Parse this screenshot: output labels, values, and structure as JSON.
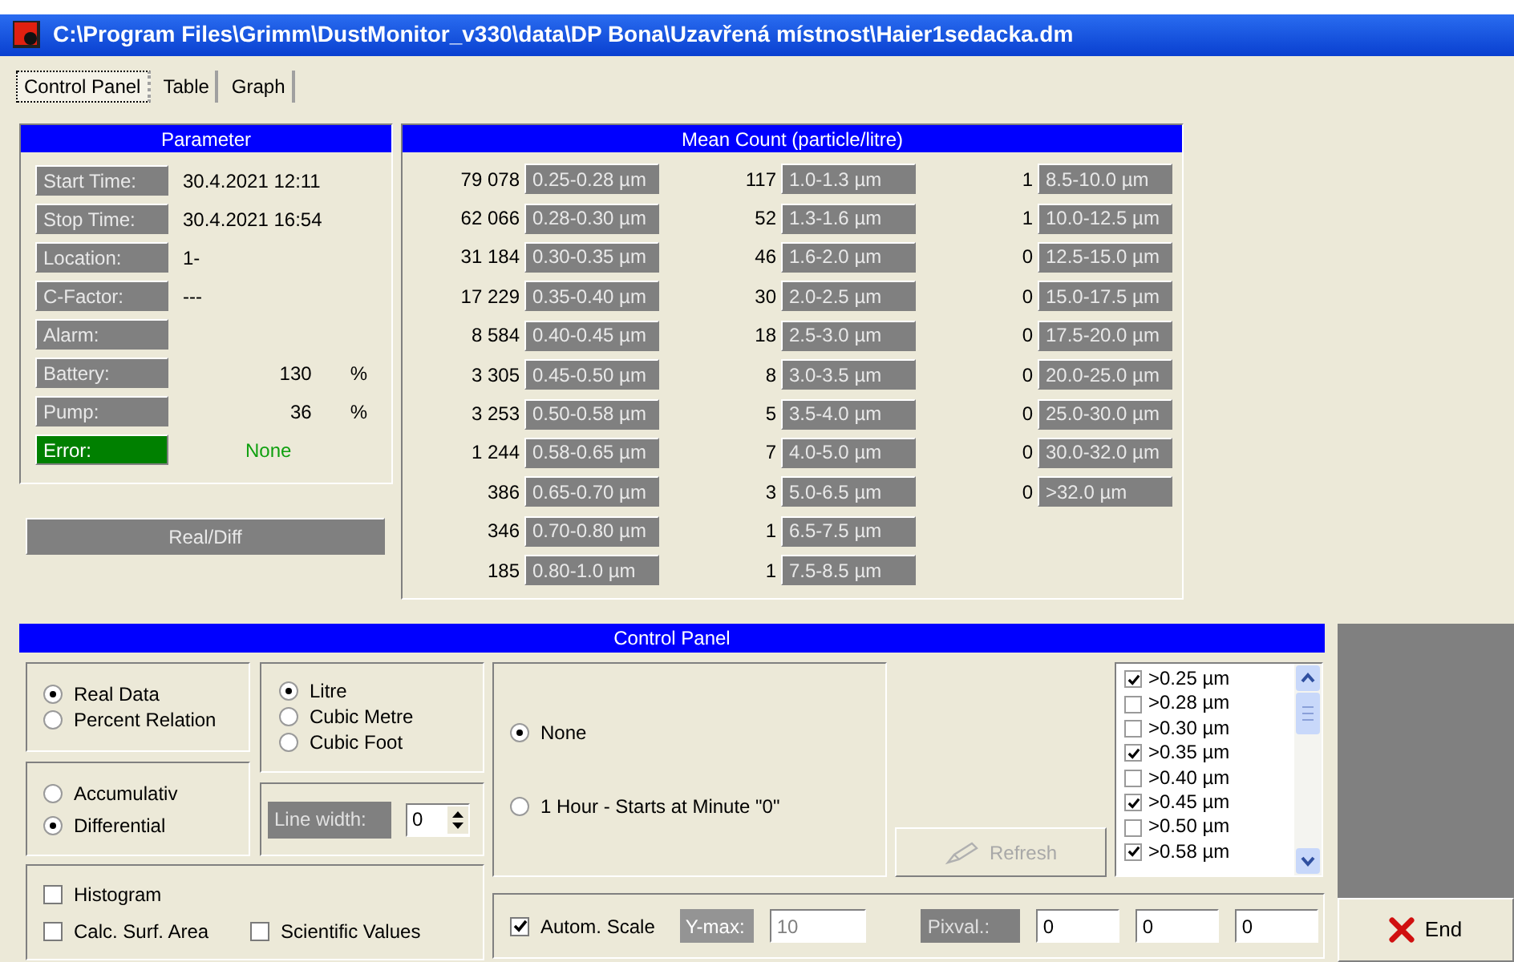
{
  "window": {
    "title": "C:\\Program Files\\Grimm\\DustMonitor_v330\\data\\DP Bona\\Uzavřená místnost\\Haier1sedacka.dm"
  },
  "tabs": [
    {
      "label": "Control Panel",
      "selected": true
    },
    {
      "label": "Table",
      "selected": false
    },
    {
      "label": "Graph",
      "selected": false
    }
  ],
  "parameter": {
    "title": "Parameter",
    "rows": [
      {
        "label": "Start Time:",
        "value": "30.4.2021 12:11",
        "kind": "text"
      },
      {
        "label": "Stop Time:",
        "value": "30.4.2021 16:54",
        "kind": "text"
      },
      {
        "label": "Location:",
        "value": "1-",
        "kind": "text"
      },
      {
        "label": "C-Factor:",
        "value": "---",
        "kind": "text"
      },
      {
        "label": "Alarm:",
        "kind": "text"
      },
      {
        "label": "Battery:",
        "value": "130",
        "unit": "%",
        "kind": "number"
      },
      {
        "label": "Pump:",
        "value": "36",
        "unit": "%",
        "kind": "number"
      },
      {
        "label": "Error:",
        "value": "None",
        "kind": "status"
      }
    ],
    "button": "Real/Diff"
  },
  "mean_count": {
    "title": "Mean Count (particle/litre)",
    "columns": [
      [
        {
          "count": "79 078",
          "range": "0.25-0.28 µm"
        },
        {
          "count": "62 066",
          "range": "0.28-0.30 µm"
        },
        {
          "count": "31 184",
          "range": "0.30-0.35 µm"
        },
        {
          "count": "17 229",
          "range": "0.35-0.40 µm"
        },
        {
          "count": "8 584",
          "range": "0.40-0.45 µm"
        },
        {
          "count": "3 305",
          "range": "0.45-0.50 µm"
        },
        {
          "count": "3 253",
          "range": "0.50-0.58 µm"
        },
        {
          "count": "1 244",
          "range": "0.58-0.65 µm"
        },
        {
          "count": "386",
          "range": "0.65-0.70 µm"
        },
        {
          "count": "346",
          "range": "0.70-0.80 µm"
        },
        {
          "count": "185",
          "range": "0.80-1.0 µm"
        }
      ],
      [
        {
          "count": "117",
          "range": "1.0-1.3 µm"
        },
        {
          "count": "52",
          "range": "1.3-1.6 µm"
        },
        {
          "count": "46",
          "range": "1.6-2.0 µm"
        },
        {
          "count": "30",
          "range": "2.0-2.5 µm"
        },
        {
          "count": "18",
          "range": "2.5-3.0 µm"
        },
        {
          "count": "8",
          "range": "3.0-3.5 µm"
        },
        {
          "count": "5",
          "range": "3.5-4.0 µm"
        },
        {
          "count": "7",
          "range": "4.0-5.0 µm"
        },
        {
          "count": "3",
          "range": "5.0-6.5 µm"
        },
        {
          "count": "1",
          "range": "6.5-7.5 µm"
        },
        {
          "count": "1",
          "range": "7.5-8.5 µm"
        }
      ],
      [
        {
          "count": "1",
          "range": "8.5-10.0 µm"
        },
        {
          "count": "1",
          "range": "10.0-12.5 µm"
        },
        {
          "count": "0",
          "range": "12.5-15.0 µm"
        },
        {
          "count": "0",
          "range": "15.0-17.5 µm"
        },
        {
          "count": "0",
          "range": "17.5-20.0 µm"
        },
        {
          "count": "0",
          "range": "20.0-25.0 µm"
        },
        {
          "count": "0",
          "range": "25.0-30.0 µm"
        },
        {
          "count": "0",
          "range": "30.0-32.0 µm"
        },
        {
          "count": "0",
          "range": ">32.0 µm"
        }
      ]
    ]
  },
  "control_panel": {
    "title": "Control Panel",
    "data_mode": [
      {
        "label": "Real Data",
        "selected": true
      },
      {
        "label": "Percent Relation",
        "selected": false
      }
    ],
    "volume_unit": [
      {
        "label": "Litre",
        "selected": true
      },
      {
        "label": "Cubic Metre",
        "selected": false
      },
      {
        "label": "Cubic Foot",
        "selected": false
      }
    ],
    "sum_mode": [
      {
        "label": "Accumulativ",
        "selected": false
      },
      {
        "label": "Differential",
        "selected": true
      }
    ],
    "line_width": {
      "label": "Line width:",
      "value": "0"
    },
    "options": [
      {
        "label": "Histogram",
        "checked": false
      },
      {
        "label": "Calc. Surf. Area",
        "checked": false
      },
      {
        "label": "Scientific Values",
        "checked": false
      }
    ],
    "interval": [
      {
        "label": "None",
        "selected": true
      },
      {
        "label": "1 Hour - Starts at Minute \"0\"",
        "selected": false
      }
    ],
    "refresh": {
      "label": "Refresh",
      "disabled": true
    },
    "size_channels": [
      {
        "label": ">0.25 µm",
        "checked": true
      },
      {
        "label": ">0.28 µm",
        "checked": false
      },
      {
        "label": ">0.30 µm",
        "checked": false
      },
      {
        "label": ">0.35 µm",
        "checked": true
      },
      {
        "label": ">0.40 µm",
        "checked": false
      },
      {
        "label": ">0.45 µm",
        "checked": true
      },
      {
        "label": ">0.50 µm",
        "checked": false
      },
      {
        "label": ">0.58 µm",
        "checked": true
      }
    ],
    "autom_scale": {
      "label": "Autom. Scale",
      "checked": true
    },
    "y_max": {
      "label": "Y-max:",
      "value": "10",
      "disabled": true
    },
    "pixval": {
      "label": "Pixval.:",
      "values": [
        "0",
        "0",
        "0"
      ]
    }
  },
  "end_button": {
    "label": "End"
  }
}
